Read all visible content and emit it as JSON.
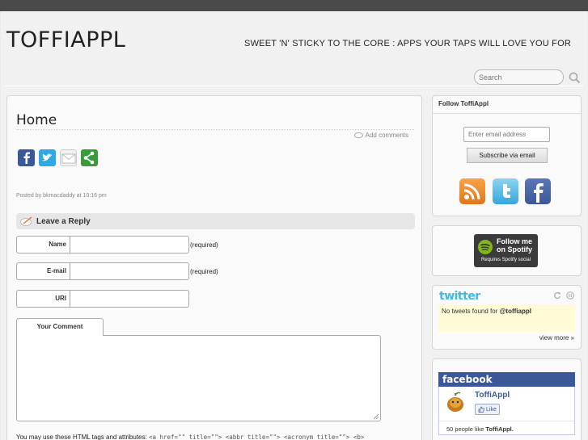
{
  "header": {
    "site_title": "TOFFIAPPL",
    "tagline": "SWEET 'N' STICKY TO THE CORE : APPS YOUR TAPS WILL LOVE YOU FOR",
    "search_placeholder": "Search"
  },
  "post": {
    "title": "Home",
    "add_comments": "Add comments",
    "posted_prefix": "Posted by",
    "author": "bkmacdaddy",
    "time_prefix": "at",
    "time": "10:16 pm",
    "share_icons": [
      "facebook-icon",
      "twitter-icon",
      "email-icon",
      "share-icon"
    ]
  },
  "reply": {
    "heading": "Leave a Reply",
    "name_label": "Name",
    "email_label": "E-mail",
    "uri_label": "URI",
    "required_note": "(required)",
    "comment_tab": "Your Comment",
    "allowed_prefix": "You may use these HTML tags and attributes:",
    "allowed_tags": "<a href=\"\" title=\"\"> <abbr title=\"\"> <acronym title=\"\"> <b>"
  },
  "sidebar": {
    "follow_title": "Follow ToffiAppl",
    "email_placeholder": "Enter email address",
    "subscribe_label": "Subscribe via email",
    "social_icons": [
      "rss-icon",
      "twitter-icon",
      "facebook-icon"
    ],
    "spotify_line1": "Follow me",
    "spotify_line2": "on Spotify",
    "spotify_line3": "Requires Spotify social",
    "twitter_logo": "twitter",
    "no_tweets": "No tweets found for",
    "handle": "@toffiappl",
    "view_more": "view more »",
    "fb_logo": "facebook",
    "fb_page": "ToffiAppl",
    "fb_like": "Like",
    "fb_people_prefix": "50 people like",
    "fb_people_page": "ToffiAppl."
  },
  "colors": {
    "facebook": "#3b5998",
    "twitter": "#2fa9e1",
    "share": "#3a9a3e",
    "rss": "#f08a24",
    "spotify": "#81b71a"
  }
}
